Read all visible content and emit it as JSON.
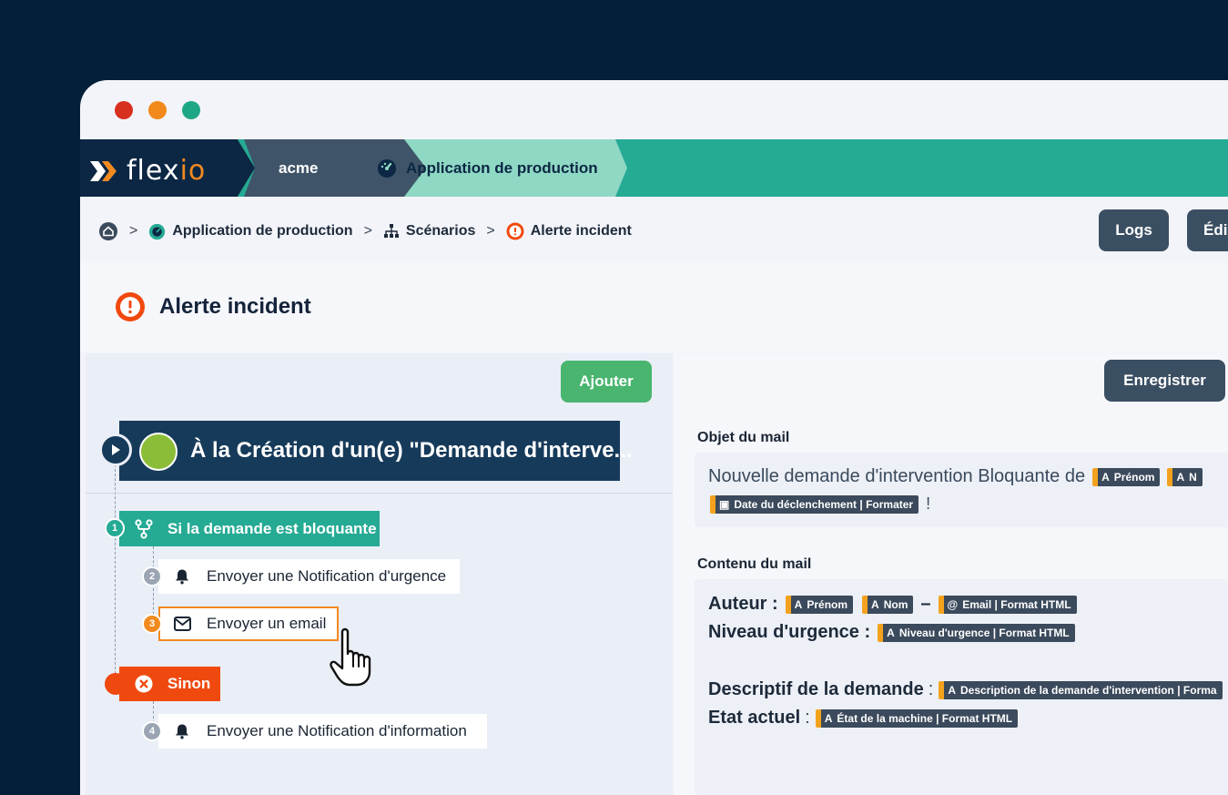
{
  "colors": {
    "background": "#02203a",
    "window": "#f3f4fa",
    "topbar_teal": "#25aa94",
    "navy": "#0b2744",
    "slate": "#3f5468",
    "mint": "#8fd8c4",
    "accent_orange": "#f28a1f",
    "green": "#49b56f",
    "danger": "#f0490f"
  },
  "window_dots": [
    "#d7301f",
    "#f18a1a",
    "#1ea785"
  ],
  "topbar": {
    "logo": "flexio",
    "org": "acme",
    "app": "Application de production"
  },
  "breadcrumb": {
    "home_icon": "home-icon",
    "items": [
      "Application de production",
      "Scénarios",
      "Alerte incident"
    ],
    "separator": ">"
  },
  "header_buttons": {
    "logs": "Logs",
    "edit": "Édi"
  },
  "page": {
    "title": "Alerte incident"
  },
  "left_panel": {
    "add_button": "Ajouter",
    "trigger": "À la Création d'un(e) \"Demande d'interve...",
    "condition": {
      "number": "1",
      "label": "Si la demande est bloquante"
    },
    "actions": [
      {
        "number": "2",
        "label": "Envoyer une Notification d'urgence",
        "icon": "bell-icon"
      },
      {
        "number": "3",
        "label": "Envoyer un email",
        "icon": "mail-icon"
      }
    ],
    "else": {
      "label": "Sinon"
    },
    "else_actions": [
      {
        "number": "4",
        "label": "Envoyer une Notification d'information",
        "icon": "bell-icon"
      }
    ]
  },
  "right_panel": {
    "save_button": "Enregistrer",
    "subject_label": "Objet du mail",
    "subject_text": "Nouvelle demande d'intervention Bloquante de",
    "subject_chips": [
      "Prénom",
      "N"
    ],
    "subject_chip_date": "Date du déclenchement | Formater",
    "subject_end": "!",
    "content_label": "Contenu du mail",
    "author_label": "Auteur :",
    "author_chips": [
      "Prénom",
      "Nom"
    ],
    "author_dash": "–",
    "author_email_chip": "Email | Format HTML",
    "urgency_label": "Niveau d'urgence :",
    "urgency_chip": "Niveau d'urgence | Format HTML",
    "desc_label": "Descriptif de la demande",
    "desc_colon": ":",
    "desc_chip": "Description de la demande d'intervention | Forma",
    "state_label": "Etat actuel",
    "state_colon": ":",
    "state_chip": "État de la machine | Format HTML"
  }
}
